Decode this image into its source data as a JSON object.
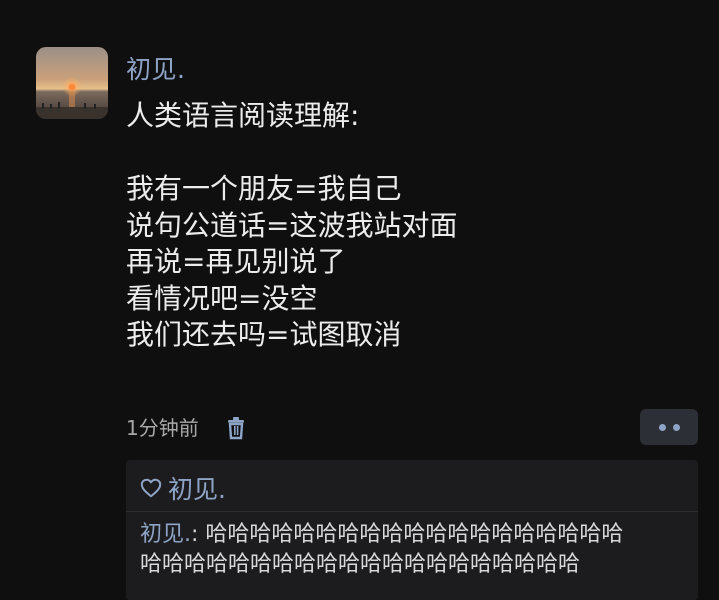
{
  "post": {
    "author": "初见.",
    "content_lines": [
      "人类语言阅读理解:",
      "",
      "我有一个朋友=我自己",
      "说句公道话=这波我站对面",
      "再说=再见别说了",
      "看情况吧=没空",
      "我们还去吗=试图取消"
    ],
    "time": "1分钟前",
    "icons": {
      "delete": "trash-icon",
      "more": "more-dots-icon",
      "like": "heart-icon"
    }
  },
  "interactions": {
    "likes": "初见.",
    "comment": {
      "author": "初见.",
      "separator": ": ",
      "text_line1": "哈哈哈哈哈哈哈哈哈哈哈哈哈哈哈哈哈哈哈",
      "text_line2": "哈哈哈哈哈哈哈哈哈哈哈哈哈哈哈哈哈哈哈哈"
    }
  },
  "colors": {
    "background": "#0f0f10",
    "name_blue": "#8ea4c6",
    "panel": "#1c1c1e",
    "button": "#2c2f35"
  }
}
